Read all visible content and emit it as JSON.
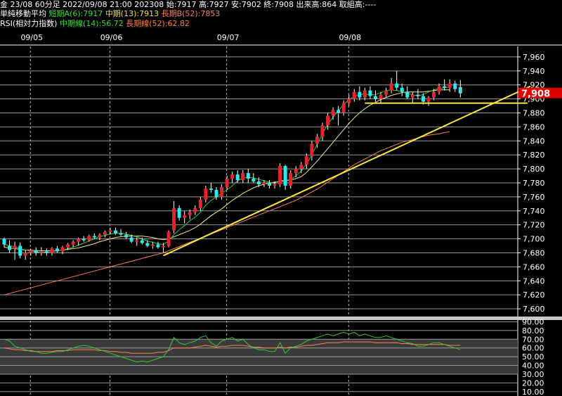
{
  "header": {
    "line1": "金 23/08 60分足 2022/09/08 21:00 202308 始:7917 高:7927 安:7902 終:7908 出来高:864 取組高:----",
    "ma_title": "単純移動平均",
    "ma_short": "短期A(6):7917",
    "ma_mid": "中期(13):7913",
    "ma_long": "長期B(52):7853",
    "rsi_title": "RSI(相対力指数)",
    "rsi_mid": "中期線(14):56.72",
    "rsi_long": "長期線(52):62.82"
  },
  "colors": {
    "up_candle": "#e8222a",
    "down_candle": "#2ee8f0",
    "ma_short": "#33cc33",
    "ma_mid": "#f0e68c",
    "ma_long": "#ff7f50",
    "trendline": "#ffe640",
    "rsi_mid": "#33cc33",
    "rsi_long": "#ff7f50",
    "price_tag": "#e00000"
  },
  "chart_data": [
    {
      "type": "candlestick",
      "title": "",
      "x_dates": [
        "09/05",
        "09/06",
        "09/07",
        "09/08"
      ],
      "ylim": [
        7590,
        7975
      ],
      "y_ticks": [
        7600,
        7620,
        7640,
        7660,
        7680,
        7700,
        7720,
        7740,
        7760,
        7780,
        7800,
        7820,
        7840,
        7860,
        7880,
        7900,
        7920,
        7940,
        7960
      ],
      "y_tick_labels": [
        "7,600",
        "7,620",
        "7,640",
        "7,660",
        "7,680",
        "7,700",
        "7,720",
        "7,740",
        "7,760",
        "7,780",
        "7,800",
        "7,820",
        "7,840",
        "7,860",
        "7,880",
        "7,900",
        "7,920",
        "7,940",
        "7,960"
      ],
      "grid": true,
      "last_price_label": "7,908",
      "last_price": 7908,
      "candles": [
        {
          "o": 7700,
          "h": 7702,
          "l": 7688,
          "c": 7692
        },
        {
          "o": 7690,
          "h": 7698,
          "l": 7680,
          "c": 7684
        },
        {
          "o": 7686,
          "h": 7696,
          "l": 7670,
          "c": 7690
        },
        {
          "o": 7690,
          "h": 7695,
          "l": 7672,
          "c": 7676
        },
        {
          "o": 7676,
          "h": 7684,
          "l": 7670,
          "c": 7680
        },
        {
          "o": 7680,
          "h": 7686,
          "l": 7676,
          "c": 7684
        },
        {
          "o": 7684,
          "h": 7688,
          "l": 7676,
          "c": 7680
        },
        {
          "o": 7680,
          "h": 7688,
          "l": 7676,
          "c": 7682
        },
        {
          "o": 7682,
          "h": 7686,
          "l": 7676,
          "c": 7680
        },
        {
          "o": 7680,
          "h": 7688,
          "l": 7676,
          "c": 7686
        },
        {
          "o": 7686,
          "h": 7690,
          "l": 7680,
          "c": 7682
        },
        {
          "o": 7682,
          "h": 7690,
          "l": 7678,
          "c": 7688
        },
        {
          "o": 7688,
          "h": 7694,
          "l": 7684,
          "c": 7692
        },
        {
          "o": 7692,
          "h": 7698,
          "l": 7688,
          "c": 7696
        },
        {
          "o": 7696,
          "h": 7702,
          "l": 7690,
          "c": 7700
        },
        {
          "o": 7700,
          "h": 7704,
          "l": 7696,
          "c": 7698
        },
        {
          "o": 7698,
          "h": 7706,
          "l": 7696,
          "c": 7704
        },
        {
          "o": 7704,
          "h": 7708,
          "l": 7700,
          "c": 7702
        },
        {
          "o": 7702,
          "h": 7708,
          "l": 7698,
          "c": 7706
        },
        {
          "o": 7706,
          "h": 7712,
          "l": 7702,
          "c": 7710
        },
        {
          "o": 7710,
          "h": 7716,
          "l": 7706,
          "c": 7712
        },
        {
          "o": 7712,
          "h": 7716,
          "l": 7706,
          "c": 7708
        },
        {
          "o": 7708,
          "h": 7714,
          "l": 7704,
          "c": 7706
        },
        {
          "o": 7706,
          "h": 7710,
          "l": 7700,
          "c": 7702
        },
        {
          "o": 7702,
          "h": 7706,
          "l": 7694,
          "c": 7696
        },
        {
          "o": 7696,
          "h": 7702,
          "l": 7690,
          "c": 7698
        },
        {
          "o": 7698,
          "h": 7702,
          "l": 7692,
          "c": 7694
        },
        {
          "o": 7694,
          "h": 7698,
          "l": 7688,
          "c": 7690
        },
        {
          "o": 7690,
          "h": 7696,
          "l": 7686,
          "c": 7692
        },
        {
          "o": 7692,
          "h": 7696,
          "l": 7686,
          "c": 7688
        },
        {
          "o": 7688,
          "h": 7694,
          "l": 7680,
          "c": 7690
        },
        {
          "o": 7690,
          "h": 7712,
          "l": 7688,
          "c": 7710
        },
        {
          "o": 7712,
          "h": 7754,
          "l": 7708,
          "c": 7744
        },
        {
          "o": 7744,
          "h": 7748,
          "l": 7726,
          "c": 7730
        },
        {
          "o": 7730,
          "h": 7740,
          "l": 7722,
          "c": 7734
        },
        {
          "o": 7734,
          "h": 7742,
          "l": 7728,
          "c": 7738
        },
        {
          "o": 7738,
          "h": 7748,
          "l": 7734,
          "c": 7744
        },
        {
          "o": 7744,
          "h": 7760,
          "l": 7740,
          "c": 7756
        },
        {
          "o": 7756,
          "h": 7776,
          "l": 7752,
          "c": 7772
        },
        {
          "o": 7772,
          "h": 7780,
          "l": 7766,
          "c": 7770
        },
        {
          "o": 7770,
          "h": 7774,
          "l": 7756,
          "c": 7760
        },
        {
          "o": 7760,
          "h": 7778,
          "l": 7756,
          "c": 7774
        },
        {
          "o": 7774,
          "h": 7790,
          "l": 7770,
          "c": 7786
        },
        {
          "o": 7786,
          "h": 7796,
          "l": 7780,
          "c": 7792
        },
        {
          "o": 7792,
          "h": 7798,
          "l": 7780,
          "c": 7784
        },
        {
          "o": 7784,
          "h": 7798,
          "l": 7780,
          "c": 7794
        },
        {
          "o": 7794,
          "h": 7800,
          "l": 7780,
          "c": 7786
        },
        {
          "o": 7786,
          "h": 7794,
          "l": 7780,
          "c": 7782
        },
        {
          "o": 7782,
          "h": 7788,
          "l": 7774,
          "c": 7778
        },
        {
          "o": 7778,
          "h": 7784,
          "l": 7774,
          "c": 7780
        },
        {
          "o": 7780,
          "h": 7784,
          "l": 7772,
          "c": 7776
        },
        {
          "o": 7776,
          "h": 7782,
          "l": 7772,
          "c": 7778
        },
        {
          "o": 7778,
          "h": 7808,
          "l": 7774,
          "c": 7804
        },
        {
          "o": 7804,
          "h": 7806,
          "l": 7770,
          "c": 7776
        },
        {
          "o": 7776,
          "h": 7798,
          "l": 7772,
          "c": 7794
        },
        {
          "o": 7794,
          "h": 7804,
          "l": 7788,
          "c": 7800
        },
        {
          "o": 7800,
          "h": 7810,
          "l": 7794,
          "c": 7806
        },
        {
          "o": 7806,
          "h": 7822,
          "l": 7800,
          "c": 7818
        },
        {
          "o": 7818,
          "h": 7840,
          "l": 7812,
          "c": 7836
        },
        {
          "o": 7836,
          "h": 7850,
          "l": 7830,
          "c": 7846
        },
        {
          "o": 7846,
          "h": 7866,
          "l": 7840,
          "c": 7862
        },
        {
          "o": 7862,
          "h": 7880,
          "l": 7856,
          "c": 7876
        },
        {
          "o": 7876,
          "h": 7888,
          "l": 7870,
          "c": 7884
        },
        {
          "o": 7884,
          "h": 7890,
          "l": 7862,
          "c": 7880
        },
        {
          "o": 7880,
          "h": 7898,
          "l": 7876,
          "c": 7894
        },
        {
          "o": 7894,
          "h": 7906,
          "l": 7890,
          "c": 7900
        },
        {
          "o": 7900,
          "h": 7914,
          "l": 7896,
          "c": 7910
        },
        {
          "o": 7910,
          "h": 7918,
          "l": 7898,
          "c": 7902
        },
        {
          "o": 7902,
          "h": 7916,
          "l": 7898,
          "c": 7912
        },
        {
          "o": 7912,
          "h": 7918,
          "l": 7900,
          "c": 7904
        },
        {
          "o": 7904,
          "h": 7912,
          "l": 7896,
          "c": 7900
        },
        {
          "o": 7900,
          "h": 7910,
          "l": 7894,
          "c": 7906
        },
        {
          "o": 7906,
          "h": 7916,
          "l": 7902,
          "c": 7912
        },
        {
          "o": 7912,
          "h": 7930,
          "l": 7908,
          "c": 7922
        },
        {
          "o": 7922,
          "h": 7940,
          "l": 7912,
          "c": 7916
        },
        {
          "o": 7916,
          "h": 7922,
          "l": 7904,
          "c": 7910
        },
        {
          "o": 7910,
          "h": 7918,
          "l": 7900,
          "c": 7902
        },
        {
          "o": 7902,
          "h": 7910,
          "l": 7894,
          "c": 7906
        },
        {
          "o": 7906,
          "h": 7914,
          "l": 7900,
          "c": 7904
        },
        {
          "o": 7904,
          "h": 7908,
          "l": 7892,
          "c": 7896
        },
        {
          "o": 7896,
          "h": 7904,
          "l": 7890,
          "c": 7902
        },
        {
          "o": 7902,
          "h": 7914,
          "l": 7898,
          "c": 7910
        },
        {
          "o": 7910,
          "h": 7922,
          "l": 7906,
          "c": 7918
        },
        {
          "o": 7918,
          "h": 7928,
          "l": 7912,
          "c": 7916
        },
        {
          "o": 7916,
          "h": 7928,
          "l": 7910,
          "c": 7922
        },
        {
          "o": 7922,
          "h": 7926,
          "l": 7910,
          "c": 7914
        },
        {
          "o": 7917,
          "h": 7927,
          "l": 7902,
          "c": 7908
        }
      ],
      "ma_short": [
        7692,
        7690,
        7689,
        7686,
        7684,
        7683,
        7681,
        7681,
        7681,
        7682,
        7683,
        7684,
        7686,
        7688,
        7691,
        7694,
        7697,
        7700,
        7703,
        7705,
        7707,
        7708,
        7708,
        7707,
        7705,
        7703,
        7700,
        7697,
        7695,
        7693,
        7692,
        7697,
        7706,
        7713,
        7719,
        7726,
        7731,
        7738,
        7748,
        7755,
        7760,
        7765,
        7770,
        7776,
        7783,
        7787,
        7788,
        7787,
        7785,
        7783,
        7781,
        7779,
        7784,
        7783,
        7785,
        7790,
        7797,
        7807,
        7820,
        7835,
        7850,
        7864,
        7874,
        7883,
        7892,
        7899,
        7904,
        7906,
        7907,
        7906,
        7906,
        7909,
        7912,
        7913,
        7912,
        7910,
        7908,
        7906,
        7904,
        7906,
        7910,
        7913,
        7915,
        7916,
        7917
      ],
      "ma_mid": [
        7688,
        7687,
        7686,
        7685,
        7684,
        7684,
        7683,
        7683,
        7683,
        7683,
        7683,
        7684,
        7685,
        7686,
        7687,
        7689,
        7691,
        7693,
        7696,
        7698,
        7700,
        7702,
        7703,
        7704,
        7704,
        7704,
        7704,
        7703,
        7702,
        7700,
        7699,
        7700,
        7703,
        7706,
        7709,
        7712,
        7716,
        7721,
        7727,
        7733,
        7738,
        7743,
        7749,
        7755,
        7760,
        7765,
        7769,
        7773,
        7776,
        7778,
        7780,
        7781,
        7782,
        7783,
        7784,
        7786,
        7789,
        7795,
        7803,
        7811,
        7820,
        7829,
        7838,
        7847,
        7856,
        7865,
        7873,
        7880,
        7886,
        7891,
        7895,
        7899,
        7902,
        7905,
        7907,
        7909,
        7910,
        7910,
        7910,
        7910,
        7911,
        7912,
        7913,
        7913,
        7913
      ],
      "ma_long": [
        7620,
        7622,
        7624,
        7626,
        7628,
        7630,
        7632,
        7634,
        7636,
        7638,
        7640,
        7642,
        7644,
        7646,
        7648,
        7650,
        7652,
        7654,
        7656,
        7658,
        7660,
        7662,
        7664,
        7666,
        7668,
        7670,
        7672,
        7674,
        7676,
        7678,
        7680,
        7683,
        7686,
        7689,
        7692,
        7695,
        7698,
        7701,
        7704,
        7707,
        7710,
        7713,
        7716,
        7719,
        7722,
        7725,
        7728,
        7731,
        7734,
        7737,
        7740,
        7743,
        7746,
        7749,
        7752,
        7755,
        7759,
        7763,
        7767,
        7771,
        7776,
        7781,
        7786,
        7791,
        7796,
        7801,
        7806,
        7810,
        7814,
        7818,
        7822,
        7826,
        7829,
        7832,
        7835,
        7838,
        7840,
        7842,
        7844,
        7846,
        7848,
        7849,
        7850,
        7852,
        7853
      ],
      "annotations": [
        {
          "type": "trendline",
          "from": {
            "index": 30,
            "value": 7676
          },
          "to": {
            "index": 96,
            "value": 7918
          }
        },
        {
          "type": "horizontal",
          "from": {
            "index": 68,
            "value": 7894
          },
          "to": {
            "index": 96,
            "value": 7894
          }
        }
      ]
    },
    {
      "type": "line",
      "title": "",
      "ylim": [
        5,
        92
      ],
      "y_ticks": [
        10,
        20,
        30,
        40,
        50,
        60,
        70,
        80,
        90
      ],
      "y_tick_labels": [
        "10.00",
        "20.00",
        "30.00",
        "40.00",
        "50.00",
        "60.00",
        "70.00",
        "80.00",
        "90.00"
      ],
      "band": [
        30,
        70
      ],
      "rsi_mid": [
        70,
        68,
        62,
        60,
        58,
        56,
        56,
        54,
        54,
        55,
        56,
        56,
        58,
        60,
        62,
        63,
        62,
        60,
        58,
        56,
        54,
        52,
        50,
        48,
        46,
        44,
        45,
        44,
        46,
        48,
        50,
        58,
        72,
        66,
        64,
        66,
        68,
        72,
        74,
        66,
        62,
        68,
        70,
        72,
        68,
        70,
        64,
        60,
        58,
        58,
        56,
        56,
        66,
        54,
        60,
        62,
        64,
        68,
        70,
        72,
        74,
        76,
        74,
        76,
        78,
        76,
        78,
        74,
        76,
        74,
        72,
        72,
        74,
        72,
        70,
        68,
        66,
        65,
        62,
        62,
        64,
        66,
        66,
        64,
        62,
        60,
        58
      ],
      "rsi_long": [
        60,
        59,
        58,
        58,
        57,
        57,
        56,
        56,
        56,
        56,
        57,
        57,
        57,
        58,
        58,
        58,
        58,
        58,
        57,
        57,
        56,
        56,
        55,
        55,
        54,
        54,
        54,
        54,
        54,
        55,
        55,
        57,
        60,
        60,
        60,
        60,
        61,
        62,
        63,
        62,
        61,
        62,
        62,
        63,
        63,
        63,
        62,
        61,
        61,
        60,
        60,
        60,
        61,
        60,
        61,
        61,
        62,
        63,
        63,
        64,
        65,
        66,
        66,
        66,
        67,
        67,
        67,
        67,
        67,
        67,
        66,
        66,
        66,
        66,
        66,
        65,
        65,
        64,
        64,
        64,
        64,
        64,
        64,
        64,
        63,
        63,
        63
      ]
    }
  ]
}
